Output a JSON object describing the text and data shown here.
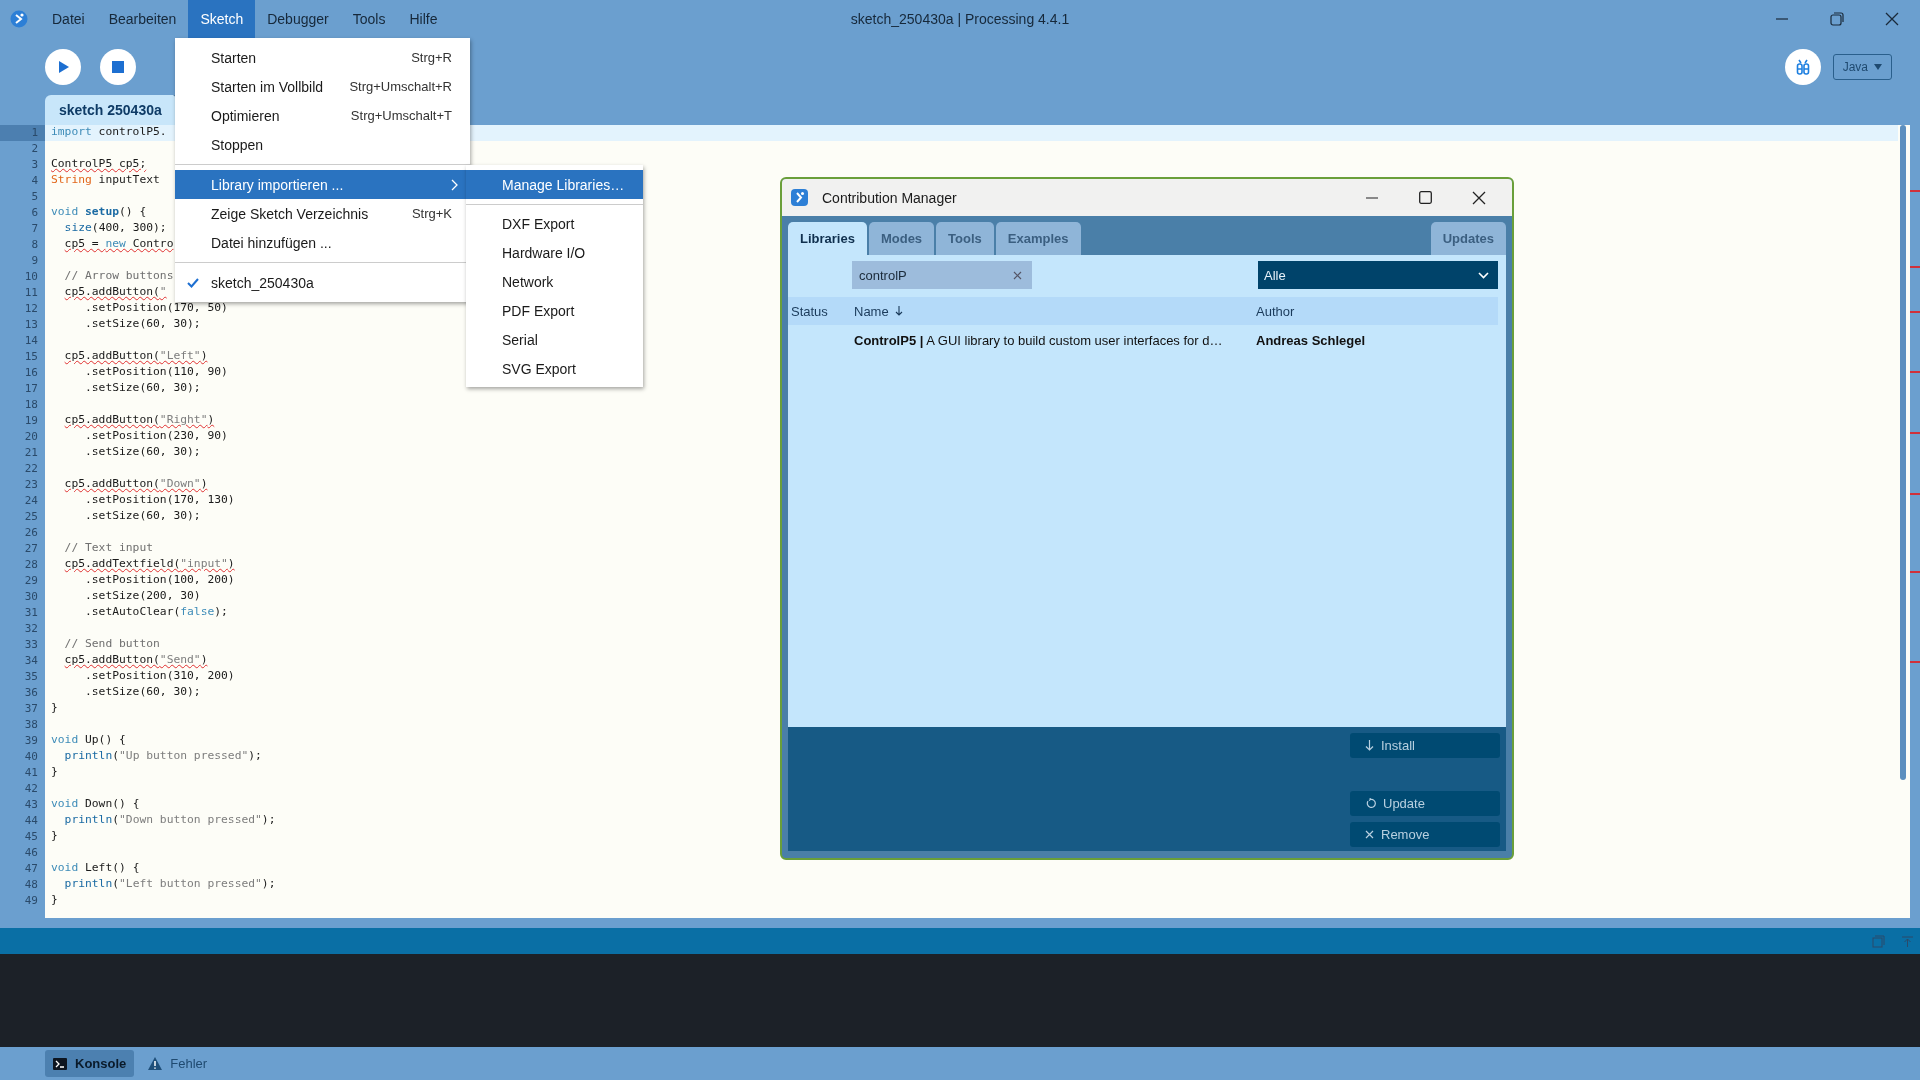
{
  "window": {
    "title": "sketch_250430a | Processing 4.4.1"
  },
  "menubar": [
    {
      "label": "Datei",
      "selected": false
    },
    {
      "label": "Bearbeiten",
      "selected": false
    },
    {
      "label": "Sketch",
      "selected": true
    },
    {
      "label": "Debugger",
      "selected": false
    },
    {
      "label": "Tools",
      "selected": false
    },
    {
      "label": "Hilfe",
      "selected": false
    }
  ],
  "sketch_menu": [
    {
      "kind": "command",
      "label": "Starten",
      "shortcut": "Strg+R",
      "selected": false
    },
    {
      "kind": "command",
      "label": "Starten im Vollbild",
      "shortcut": "Strg+Umschalt+R",
      "selected": false
    },
    {
      "kind": "command",
      "label": "Optimieren",
      "shortcut": "Strg+Umschalt+T",
      "selected": false
    },
    {
      "kind": "command",
      "label": "Stoppen",
      "selected": false
    },
    {
      "kind": "separator"
    },
    {
      "kind": "submenu",
      "label": "Library importieren ...",
      "selected": true
    },
    {
      "kind": "command",
      "label": "Zeige Sketch Verzeichnis",
      "shortcut": "Strg+K",
      "selected": false
    },
    {
      "kind": "command",
      "label": "Datei hinzufügen ...",
      "selected": false
    },
    {
      "kind": "separator"
    },
    {
      "kind": "check",
      "label": "sketch_250430a",
      "checked": true,
      "selected": false
    }
  ],
  "library_submenu": [
    {
      "kind": "command",
      "label": "Manage Libraries…",
      "selected": true
    },
    {
      "kind": "separator"
    },
    {
      "kind": "command",
      "label": "DXF Export",
      "selected": false
    },
    {
      "kind": "command",
      "label": "Hardware I/O",
      "selected": false
    },
    {
      "kind": "command",
      "label": "Network",
      "selected": false
    },
    {
      "kind": "command",
      "label": "PDF Export",
      "selected": false
    },
    {
      "kind": "command",
      "label": "Serial",
      "selected": false
    },
    {
      "kind": "command",
      "label": "SVG Export",
      "selected": false
    }
  ],
  "toolbar": {
    "mode": "Java"
  },
  "editor": {
    "tabs": [
      {
        "label": "sketch 250430a",
        "selected": true
      }
    ],
    "lines": [
      {
        "n": "1",
        "current": true,
        "error": false,
        "tokens": [
          {
            "text": "import",
            "kind": "keyword"
          },
          {
            "text": " controlP5.",
            "kind": "plain"
          }
        ]
      },
      {
        "n": "2",
        "current": false
      },
      {
        "n": "3",
        "current": false,
        "error": true,
        "tokens": [
          {
            "text": "ControlP5 cp5;",
            "kind": "plain"
          }
        ]
      },
      {
        "n": "4",
        "current": false,
        "error": false,
        "tokens": [
          {
            "text": "String",
            "kind": "type"
          },
          {
            "text": " inputText",
            "kind": "plain"
          }
        ]
      },
      {
        "n": "5",
        "current": false
      },
      {
        "n": "6",
        "current": false,
        "error": false,
        "tokens": [
          {
            "text": "void",
            "kind": "keyword"
          },
          {
            "text": " setup",
            "kind": "function-def"
          },
          {
            "text": "() {",
            "kind": "plain"
          }
        ]
      },
      {
        "n": "7",
        "current": false,
        "error": false,
        "tokens": [
          {
            "text": "  size",
            "kind": "function"
          },
          {
            "text": "(400, 300);",
            "kind": "plain"
          }
        ]
      },
      {
        "n": "8",
        "current": false,
        "error": true,
        "tokens": [
          {
            "text": "  cp5 = ",
            "kind": "plain"
          },
          {
            "text": "new",
            "kind": "keyword"
          },
          {
            "text": " Contro",
            "kind": "plain"
          }
        ]
      },
      {
        "n": "9",
        "current": false
      },
      {
        "n": "10",
        "current": false,
        "error": false,
        "tokens": [
          {
            "text": "  // Arrow buttons",
            "kind": "comment"
          }
        ]
      },
      {
        "n": "11",
        "current": false,
        "error": true,
        "tokens": [
          {
            "text": "  cp5.addButton(",
            "kind": "plain"
          },
          {
            "text": "\"",
            "kind": "string"
          }
        ]
      },
      {
        "n": "12",
        "current": false,
        "error": false,
        "tokens": [
          {
            "text": "     .setPosition(170, 50)",
            "kind": "plain"
          }
        ]
      },
      {
        "n": "13",
        "current": false,
        "error": false,
        "tokens": [
          {
            "text": "     .setSize(60, 30);",
            "kind": "plain"
          }
        ]
      },
      {
        "n": "14",
        "current": false
      },
      {
        "n": "15",
        "current": false,
        "error": true,
        "tokens": [
          {
            "text": "  cp5.addButton(",
            "kind": "plain"
          },
          {
            "text": "\"Left\"",
            "kind": "string"
          },
          {
            "text": ")",
            "kind": "plain"
          }
        ]
      },
      {
        "n": "16",
        "current": false,
        "error": false,
        "tokens": [
          {
            "text": "     .setPosition(110, 90)",
            "kind": "plain"
          }
        ]
      },
      {
        "n": "17",
        "current": false,
        "error": false,
        "tokens": [
          {
            "text": "     .setSize(60, 30);",
            "kind": "plain"
          }
        ]
      },
      {
        "n": "18",
        "current": false
      },
      {
        "n": "19",
        "current": false,
        "error": true,
        "tokens": [
          {
            "text": "  cp5.addButton(",
            "kind": "plain"
          },
          {
            "text": "\"Right\"",
            "kind": "string"
          },
          {
            "text": ")",
            "kind": "plain"
          }
        ]
      },
      {
        "n": "20",
        "current": false,
        "error": false,
        "tokens": [
          {
            "text": "     .setPosition(230, 90)",
            "kind": "plain"
          }
        ]
      },
      {
        "n": "21",
        "current": false,
        "error": false,
        "tokens": [
          {
            "text": "     .setSize(60, 30);",
            "kind": "plain"
          }
        ]
      },
      {
        "n": "22",
        "current": false
      },
      {
        "n": "23",
        "current": false,
        "error": true,
        "tokens": [
          {
            "text": "  cp5.addButton(",
            "kind": "plain"
          },
          {
            "text": "\"Down\"",
            "kind": "string"
          },
          {
            "text": ")",
            "kind": "plain"
          }
        ]
      },
      {
        "n": "24",
        "current": false,
        "error": false,
        "tokens": [
          {
            "text": "     .setPosition(170, 130)",
            "kind": "plain"
          }
        ]
      },
      {
        "n": "25",
        "current": false,
        "error": false,
        "tokens": [
          {
            "text": "     .setSize(60, 30);",
            "kind": "plain"
          }
        ]
      },
      {
        "n": "26",
        "current": false
      },
      {
        "n": "27",
        "current": false,
        "error": false,
        "tokens": [
          {
            "text": "  // Text input",
            "kind": "comment"
          }
        ]
      },
      {
        "n": "28",
        "current": false,
        "error": true,
        "tokens": [
          {
            "text": "  cp5.addTextfield(",
            "kind": "plain"
          },
          {
            "text": "\"input\"",
            "kind": "string"
          },
          {
            "text": ")",
            "kind": "plain"
          }
        ]
      },
      {
        "n": "29",
        "current": false,
        "error": false,
        "tokens": [
          {
            "text": "     .setPosition(100, 200)",
            "kind": "plain"
          }
        ]
      },
      {
        "n": "30",
        "current": false,
        "error": false,
        "tokens": [
          {
            "text": "     .setSize(200, 30)",
            "kind": "plain"
          }
        ]
      },
      {
        "n": "31",
        "current": false,
        "error": false,
        "tokens": [
          {
            "text": "     .setAutoClear(",
            "kind": "plain"
          },
          {
            "text": "false",
            "kind": "keyword"
          },
          {
            "text": ");",
            "kind": "plain"
          }
        ]
      },
      {
        "n": "32",
        "current": false
      },
      {
        "n": "33",
        "current": false,
        "error": false,
        "tokens": [
          {
            "text": "  // Send button",
            "kind": "comment"
          }
        ]
      },
      {
        "n": "34",
        "current": false,
        "error": true,
        "tokens": [
          {
            "text": "  cp5.addButton(",
            "kind": "plain"
          },
          {
            "text": "\"Send\"",
            "kind": "string"
          },
          {
            "text": ")",
            "kind": "plain"
          }
        ]
      },
      {
        "n": "35",
        "current": false,
        "error": false,
        "tokens": [
          {
            "text": "     .setPosition(310, 200)",
            "kind": "plain"
          }
        ]
      },
      {
        "n": "36",
        "current": false,
        "error": false,
        "tokens": [
          {
            "text": "     .setSize(60, 30);",
            "kind": "plain"
          }
        ]
      },
      {
        "n": "37",
        "current": false,
        "error": false,
        "tokens": [
          {
            "text": "}",
            "kind": "plain"
          }
        ]
      },
      {
        "n": "38",
        "current": false
      },
      {
        "n": "39",
        "current": false,
        "error": false,
        "tokens": [
          {
            "text": "void",
            "kind": "keyword"
          },
          {
            "text": " Up() {",
            "kind": "plain"
          }
        ]
      },
      {
        "n": "40",
        "current": false,
        "error": false,
        "tokens": [
          {
            "text": "  println",
            "kind": "function"
          },
          {
            "text": "(",
            "kind": "plain"
          },
          {
            "text": "\"Up button pressed\"",
            "kind": "string"
          },
          {
            "text": ");",
            "kind": "plain"
          }
        ]
      },
      {
        "n": "41",
        "current": false,
        "error": false,
        "tokens": [
          {
            "text": "}",
            "kind": "plain"
          }
        ]
      },
      {
        "n": "42",
        "current": false
      },
      {
        "n": "43",
        "current": false,
        "error": false,
        "tokens": [
          {
            "text": "void",
            "kind": "keyword"
          },
          {
            "text": " Down() {",
            "kind": "plain"
          }
        ]
      },
      {
        "n": "44",
        "current": false,
        "error": false,
        "tokens": [
          {
            "text": "  println",
            "kind": "function"
          },
          {
            "text": "(",
            "kind": "plain"
          },
          {
            "text": "\"Down button pressed\"",
            "kind": "string"
          },
          {
            "text": ");",
            "kind": "plain"
          }
        ]
      },
      {
        "n": "45",
        "current": false,
        "error": false,
        "tokens": [
          {
            "text": "}",
            "kind": "plain"
          }
        ]
      },
      {
        "n": "46",
        "current": false
      },
      {
        "n": "47",
        "current": false,
        "error": false,
        "tokens": [
          {
            "text": "void",
            "kind": "keyword"
          },
          {
            "text": " Left() {",
            "kind": "plain"
          }
        ]
      },
      {
        "n": "48",
        "current": false,
        "error": false,
        "tokens": [
          {
            "text": "  println",
            "kind": "function"
          },
          {
            "text": "(",
            "kind": "plain"
          },
          {
            "text": "\"Left button pressed\"",
            "kind": "string"
          },
          {
            "text": ");",
            "kind": "plain"
          }
        ]
      },
      {
        "n": "49",
        "current": false,
        "error": false,
        "tokens": [
          {
            "text": "}",
            "kind": "plain"
          }
        ]
      }
    ]
  },
  "console_tabs": [
    {
      "label": "Konsole",
      "kind": "console",
      "selected": true
    },
    {
      "label": "Fehler",
      "kind": "errors",
      "selected": false
    }
  ],
  "contribution_manager": {
    "title": "Contribution Manager",
    "tabs": [
      {
        "label": "Libraries",
        "selected": true
      },
      {
        "label": "Modes",
        "selected": false
      },
      {
        "label": "Tools",
        "selected": false
      },
      {
        "label": "Examples",
        "selected": false
      },
      {
        "label": "Updates",
        "selected": false
      }
    ],
    "search": {
      "value": "controlP"
    },
    "filter": {
      "value": "Alle"
    },
    "columns": [
      "Status",
      "Name",
      "Author"
    ],
    "rows": [
      {
        "name": "**ControlP5 |** A GUI library to build custom user interfaces for d…",
        "author": "Andreas Schlegel"
      }
    ],
    "buttons": [
      {
        "label": "Install",
        "kind": "install"
      },
      {
        "label": "Update",
        "kind": "update"
      },
      {
        "label": "Remove",
        "kind": "remove"
      }
    ]
  }
}
